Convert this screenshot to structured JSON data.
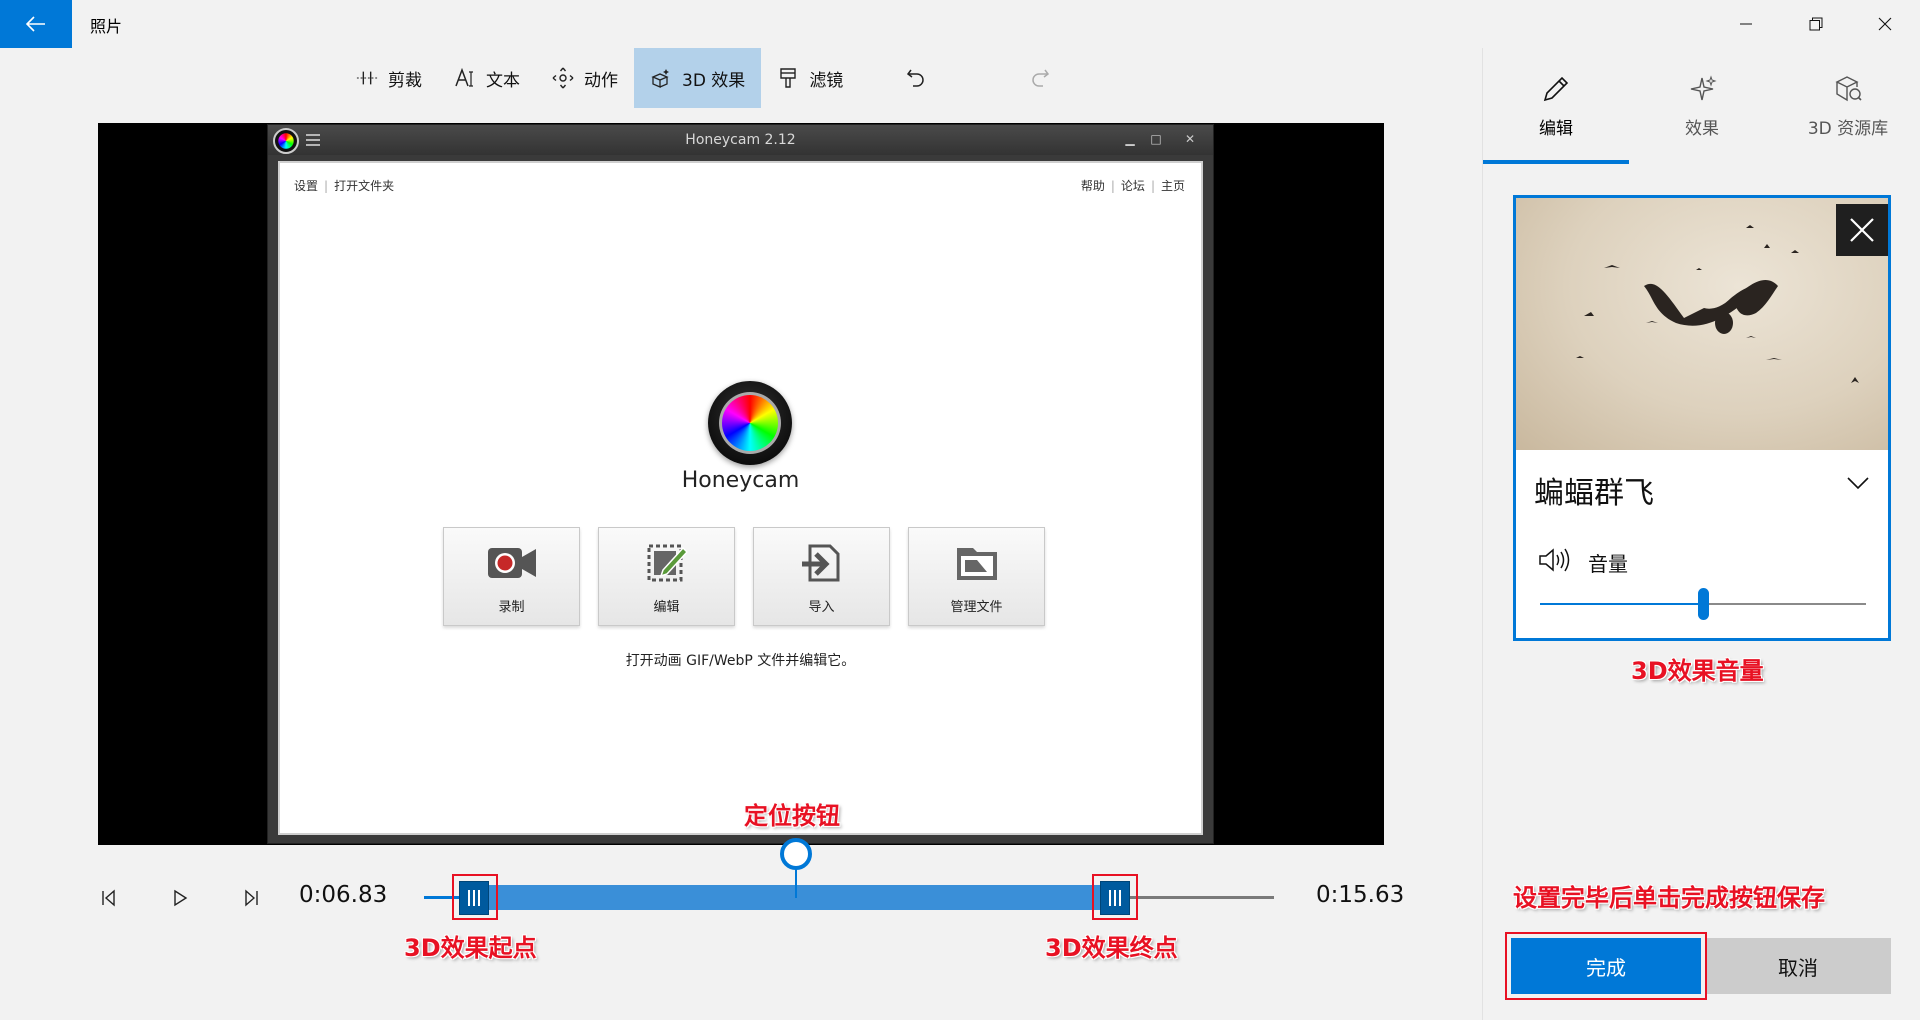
{
  "window": {
    "title": "照片",
    "back_icon": "arrow-left-icon",
    "minimize_icon": "minimize-icon",
    "restore_icon": "restore-icon",
    "close_icon": "close-icon"
  },
  "colors": {
    "accent": "#0078d7",
    "annotation": "#e81123",
    "active_tab_bg": "#b3d1ea"
  },
  "toolbar": {
    "items": [
      {
        "label": "剪裁",
        "icon": "trim-icon",
        "active": false
      },
      {
        "label": "文本",
        "icon": "text-icon",
        "active": false
      },
      {
        "label": "动作",
        "icon": "motion-icon",
        "active": false
      },
      {
        "label": "3D 效果",
        "icon": "3d-effects-icon",
        "active": true
      },
      {
        "label": "滤镜",
        "icon": "filter-icon",
        "active": false
      }
    ],
    "undo_icon": "undo-icon",
    "redo_icon": "redo-icon"
  },
  "preview": {
    "app_title": "Honeycam 2.12",
    "nav_left": [
      "设置",
      "打开文件夹"
    ],
    "nav_right": [
      "帮助",
      "论坛",
      "主页"
    ],
    "app_name": "Honeycam",
    "actions": [
      {
        "label": "录制",
        "icon": "record-icon"
      },
      {
        "label": "编辑",
        "icon": "edit-icon"
      },
      {
        "label": "导入",
        "icon": "import-icon"
      },
      {
        "label": "管理文件",
        "icon": "manage-files-icon"
      }
    ],
    "hint": "打开动画 GIF/WebP 文件并编辑它。"
  },
  "playback": {
    "current_time": "0:06.83",
    "end_time": "0:15.63",
    "prev_frame_icon": "step-back-icon",
    "play_icon": "play-icon",
    "next_frame_icon": "step-forward-icon",
    "progress_fraction": 0.437
  },
  "annotations": {
    "playhead": "定位按钮",
    "start": "3D效果起点",
    "end": "3D效果终点",
    "volume": "3D效果音量",
    "save_hint": "设置完毕后单击完成按钮保存"
  },
  "right_panel": {
    "tabs": [
      {
        "label": "编辑",
        "icon": "pencil-icon",
        "active": true
      },
      {
        "label": "效果",
        "icon": "sparkle-icon",
        "active": false
      },
      {
        "label": "3D 资源库",
        "icon": "3d-library-icon",
        "active": false
      }
    ],
    "effect": {
      "name": "蝙蝠群飞",
      "close_icon": "close-icon",
      "chevron_icon": "chevron-down-icon"
    },
    "volume": {
      "label": "音量",
      "icon": "speaker-icon",
      "level": 0.5
    },
    "done_label": "完成",
    "cancel_label": "取消"
  }
}
